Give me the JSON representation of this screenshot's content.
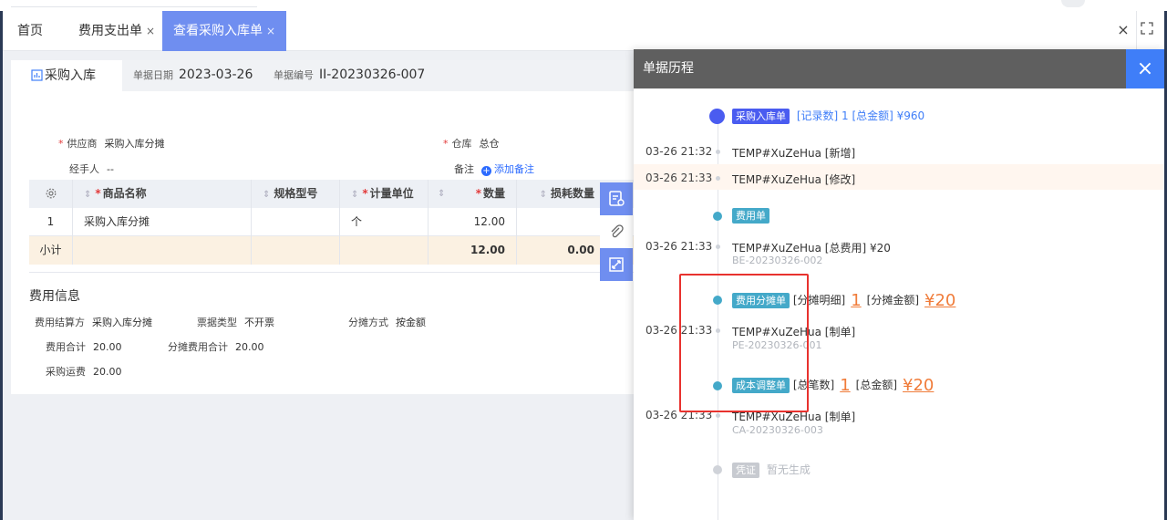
{
  "tabs": [
    {
      "label": "首页",
      "close": ""
    },
    {
      "label": "费用支出单",
      "close": "×"
    },
    {
      "label": "查看采购入库单",
      "close": "×"
    }
  ],
  "tabbar": {
    "close_all": "×"
  },
  "doc": {
    "title": "采购入库",
    "date_label": "单据日期",
    "date": "2023-03-26",
    "no_label": "单据编号",
    "no": "II-20230326-007"
  },
  "form": {
    "supplier_label": "供应商",
    "supplier": "采购入库分摊",
    "handler_label": "经手人",
    "handler": "--",
    "warehouse_label": "仓库",
    "warehouse": "总仓",
    "remark_label": "备注",
    "add_remark": "添加备注"
  },
  "table": {
    "headers": [
      "商品名称",
      "规格型号",
      "计量单位",
      "",
      "数量",
      "损耗数量"
    ],
    "rows": [
      {
        "idx": "1",
        "name": "采购入库分摊",
        "spec": "",
        "unit": "个",
        "qty": "12.00",
        "loss": ""
      }
    ],
    "subtotal": {
      "label": "小计",
      "qty": "12.00",
      "loss": "0.00"
    }
  },
  "cost": {
    "section_title": "费用信息",
    "settle_label": "费用结算方",
    "settle": "采购入库分摊",
    "bill_type_label": "票据类型",
    "bill_type": "不开票",
    "alloc_method_label": "分摊方式",
    "alloc_method": "按金额",
    "total_label": "费用合计",
    "total": "20.00",
    "alloc_total_label": "分摊费用合计",
    "alloc_total": "20.00",
    "freight_label": "采购运费",
    "freight": "20.00"
  },
  "drawer": {
    "title": "单据历程",
    "close": "×",
    "groups": [
      {
        "badge": "采购入库单",
        "info": "[记录数] 1   [总金额] ¥960",
        "events": [
          {
            "time": "03-26 21:32",
            "text": "TEMP#XuZeHua [新增]"
          },
          {
            "time": "03-26 21:33",
            "text": "TEMP#XuZeHua [修改]"
          }
        ]
      },
      {
        "badge": "费用单",
        "info": "",
        "events": [
          {
            "time": "03-26 21:33",
            "text": "TEMP#XuZeHua [总费用] ¥20",
            "sub": "BE-20230326-002"
          }
        ]
      },
      {
        "badge": "费用分摊单",
        "info_a": "[分摊明细]",
        "count": "1",
        "info_b": "[分摊金额]",
        "amount": "¥20",
        "events": [
          {
            "time": "03-26 21:33",
            "text": "TEMP#XuZeHua [制单]",
            "sub": "PE-20230326-001"
          }
        ]
      },
      {
        "badge": "成本调整单",
        "info_a": "[总笔数]",
        "count": "1",
        "info_b": "[总金额]",
        "amount": "¥20",
        "events": [
          {
            "time": "03-26 21:33",
            "text": "TEMP#XuZeHua [制单]",
            "sub": "CA-20230326-003"
          }
        ]
      },
      {
        "badge": "凭证",
        "info": "暂无生成",
        "events": []
      }
    ]
  },
  "colors": {
    "primary": "#6f8ef0",
    "accent": "#3f7ef8",
    "teal": "#44a9c9",
    "orange": "#f07c3a",
    "highlight": "#e8322e"
  }
}
